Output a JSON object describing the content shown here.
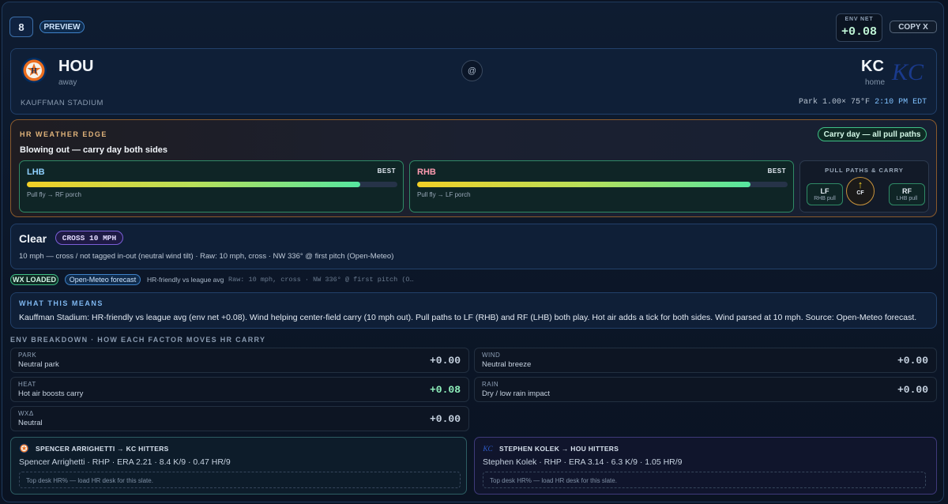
{
  "header": {
    "game_number": "8",
    "status_pill": "PREVIEW",
    "env_net_label": "ENV NET",
    "env_net_value": "+0.08",
    "copy_label": "COPY X"
  },
  "matchup": {
    "away": {
      "abbr": "HOU",
      "role": "away",
      "color": "#eb6e1f",
      "navy": "#002d62"
    },
    "home": {
      "abbr": "KC",
      "role": "home",
      "color": "#1a3a8c"
    },
    "separator": "@",
    "stadium": "KAUFFMAN STADIUM",
    "park_factor": "Park 1.00×",
    "temperature": "75°F",
    "time": "2:10 PM EDT"
  },
  "hr_edge": {
    "title": "HR WEATHER EDGE",
    "headline": "Blowing out — carry day both sides",
    "badge": "Carry day — all pull paths",
    "sides": [
      {
        "name": "LHB",
        "tag": "BEST",
        "fill": 0.9,
        "note": "Pull fly → RF porch"
      },
      {
        "name": "RHB",
        "tag": "BEST",
        "fill": 0.9,
        "note": "Pull fly → LF porch"
      }
    ],
    "pull_paths": {
      "title": "PULL PATHS & CARRY",
      "lf": {
        "label": "LF",
        "sub": "RHB pull"
      },
      "cf": {
        "label": "CF",
        "arrow": "↑"
      },
      "rf": {
        "label": "RF",
        "sub": "LHB pull"
      }
    }
  },
  "sky": {
    "condition": "Clear",
    "wind_pill": "CROSS 10 MPH",
    "detail": "10 mph — cross / not tagged in-out (neutral wind tilt) · Raw: 10 mph, cross · NW 336° @ first pitch (Open-Meteo)"
  },
  "status": {
    "wx_pill": "WX LOADED",
    "source_pill": "Open-Meteo forecast",
    "summary": "HR-friendly vs league avg",
    "raw": "Raw: 10 mph, cross · NW 336° @ first pitch (O…"
  },
  "means": {
    "title": "WHAT THIS MEANS",
    "text": "Kauffman Stadium: HR-friendly vs league avg (env net +0.08). Wind helping center-field carry (10 mph out). Pull paths to LF (RHB) and RF (LHB) both play. Hot air adds a tick for both sides. Wind parsed at 10 mph. Source: Open-Meteo forecast."
  },
  "env_breakdown": {
    "title": "ENV BREAKDOWN · HOW EACH FACTOR MOVES HR CARRY",
    "park": {
      "label": "PARK",
      "desc": "Neutral park",
      "value": "+0.00"
    },
    "wind": {
      "label": "WIND",
      "desc": "Neutral breeze",
      "value": "+0.00"
    },
    "heat": {
      "label": "HEAT",
      "desc": "Hot air boosts carry",
      "value": "+0.08"
    },
    "rain": {
      "label": "RAIN",
      "desc": "Dry / low rain impact",
      "value": "+0.00"
    },
    "wx": {
      "label": "WXΔ",
      "desc": "Neutral",
      "value": "+0.00"
    }
  },
  "pitchers": {
    "away": {
      "title": "SPENCER ARRIGHETTI → KC HITTERS",
      "line": "Spencer Arrighetti · RHP · ERA 2.21 · 8.4 K/9 · 0.47 HR/9",
      "desk": "Top desk HR% — load HR desk for this slate."
    },
    "home": {
      "title": "STEPHEN KOLEK → HOU HITTERS",
      "line": "Stephen Kolek · RHP · ERA 3.14 · 6.3 K/9 · 1.05 HR/9",
      "desk": "Top desk HR% — load HR desk for this slate."
    }
  }
}
